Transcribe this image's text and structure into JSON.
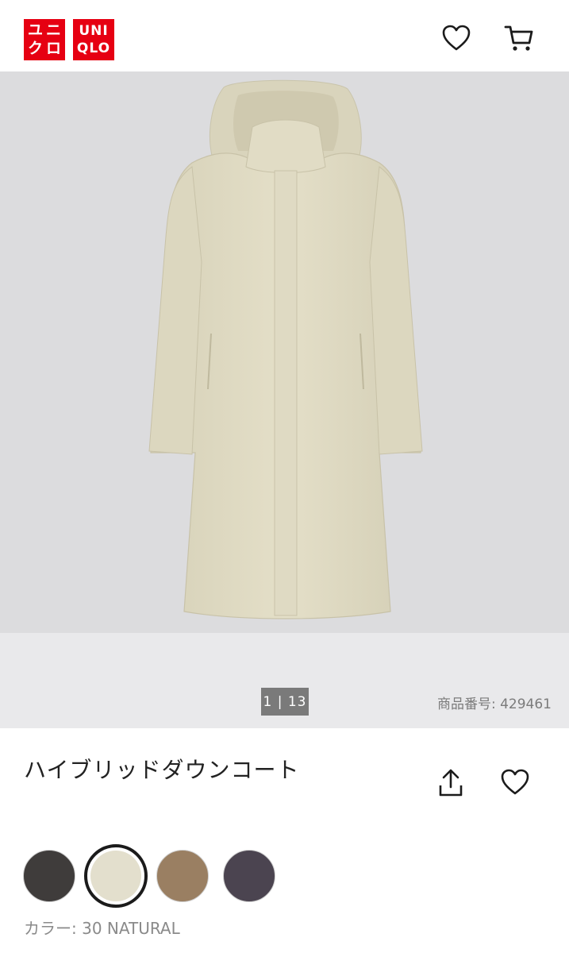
{
  "header": {
    "logo_jp_top": "ユニ",
    "logo_jp_bottom": "クロ",
    "logo_en_top": "UNI",
    "logo_en_bottom": "QLO",
    "icons": [
      "heart-icon",
      "cart-icon"
    ],
    "brand_color": "#e60012"
  },
  "gallery": {
    "pager": "1 | 13",
    "product_number_label": "商品番号",
    "product_number_value": ": 429461"
  },
  "product": {
    "title": "ハイブリッドダウンコート",
    "actions": [
      "share-icon",
      "heart-icon"
    ]
  },
  "colors": {
    "swatches": [
      "#3f3c3b",
      "#e3dfcd",
      "#9a7f62",
      "#4b4450"
    ],
    "selected_index": 1,
    "label": "カラー",
    "value": ": 30 NATURAL"
  }
}
